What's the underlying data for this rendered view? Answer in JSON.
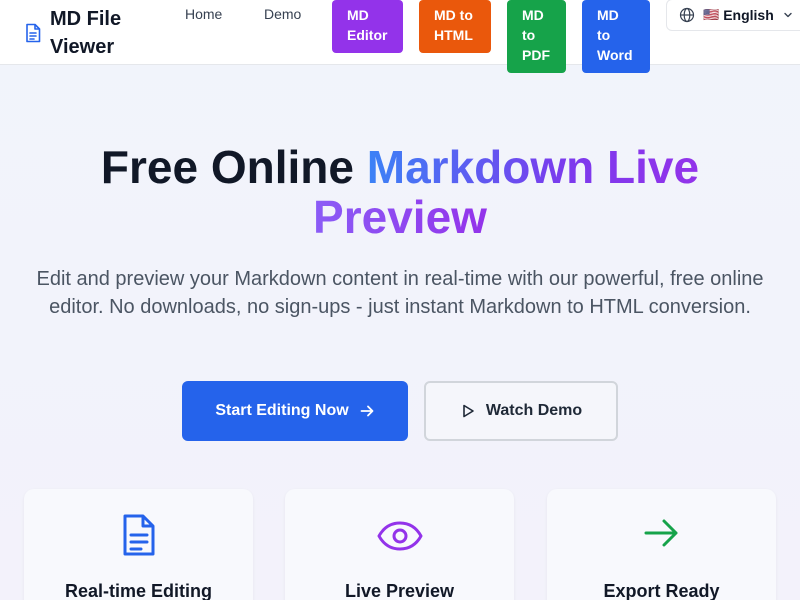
{
  "header": {
    "logo_text": "MD File Viewer",
    "nav": {
      "home": "Home",
      "demo": "Demo"
    },
    "buttons": {
      "editor": "MD Editor",
      "html": "MD to HTML",
      "pdf": "MD to PDF",
      "word": "MD to Word"
    },
    "language": {
      "flag": "🇺🇸",
      "label": "English"
    }
  },
  "hero": {
    "title_plain": "Free Online ",
    "title_grad1": "Markdown Live",
    "title_grad2": "Preview",
    "subtitle": "Edit and preview your Markdown content in real-time with our powerful, free online editor. No downloads, no sign-ups - just instant Markdown to HTML conversion.",
    "cta_primary": "Start Editing Now",
    "cta_secondary": "Watch Demo"
  },
  "features": [
    {
      "title": "Real-time Editing",
      "icon": "document-icon"
    },
    {
      "title": "Live Preview",
      "icon": "eye-icon"
    },
    {
      "title": "Export Ready",
      "icon": "arrow-right-icon"
    }
  ],
  "colors": {
    "editor": "#9333ea",
    "html": "#ea580c",
    "pdf": "#16a34a",
    "word": "#2563eb",
    "primary": "#2563eb"
  }
}
